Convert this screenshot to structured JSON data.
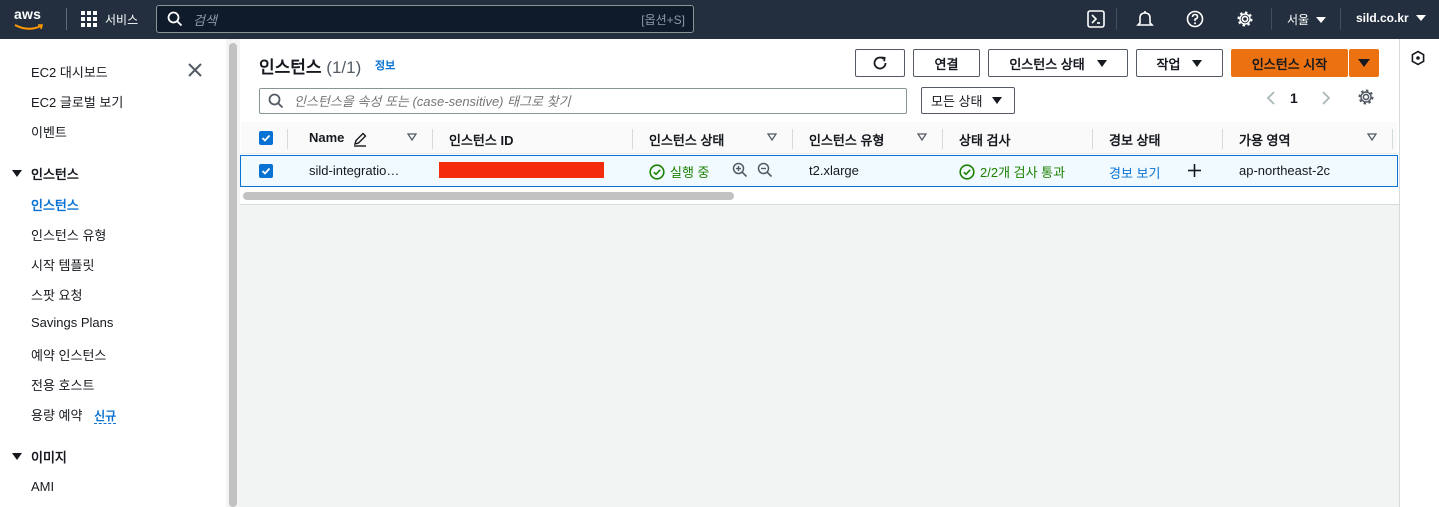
{
  "topnav": {
    "logo": "aws",
    "services_label": "서비스",
    "search_placeholder": "검색",
    "search_shortcut": "[옵션+S]",
    "region": "서울",
    "account": "sild.co.kr",
    "icons": [
      "cloudshell-icon",
      "bell-icon",
      "help-icon",
      "settings-gear-icon"
    ]
  },
  "sidebar": {
    "top_items": [
      "EC2 대시보드",
      "EC2 글로벌 보기",
      "이벤트"
    ],
    "section_instances": {
      "title": "인스턴스",
      "items": [
        "인스턴스",
        "인스턴스 유형",
        "시작 템플릿",
        "스팟 요청",
        "Savings Plans",
        "예약 인스턴스",
        "전용 호스트",
        "용량 예약"
      ],
      "active_item": "인스턴스",
      "new_badge": "신규"
    },
    "section_images": {
      "title": "이미지",
      "items": [
        "AMI"
      ]
    }
  },
  "panel": {
    "title": "인스턴스",
    "count": "(1/1)",
    "info_link": "정보",
    "buttons": {
      "connect": "연결",
      "instance_state": "인스턴스 상태",
      "actions": "작업",
      "launch": "인스턴스 시작"
    },
    "filter_placeholder": "인스턴스을 속성 또는 (case-sensitive) 태그로 찾기",
    "state_filter": "모든 상태",
    "page_number": "1"
  },
  "table": {
    "columns": [
      "Name",
      "인스턴스 ID",
      "인스턴스 상태",
      "인스턴스 유형",
      "상태 검사",
      "경보 상태",
      "가용 영역"
    ],
    "rows": [
      {
        "name": "sild-integratio…",
        "instance_id": "",
        "state": "실행 중",
        "type": "t2.xlarge",
        "status_check": "2/2개 검사 통과",
        "alarm": "경보 보기",
        "az": "ap-northeast-2c",
        "selected": true
      }
    ]
  },
  "colors": {
    "nav_bg": "#232f3e",
    "accent": "#0972d3",
    "primary": "#ec7211",
    "success": "#1d8102",
    "redaction": "#f52b0e"
  }
}
